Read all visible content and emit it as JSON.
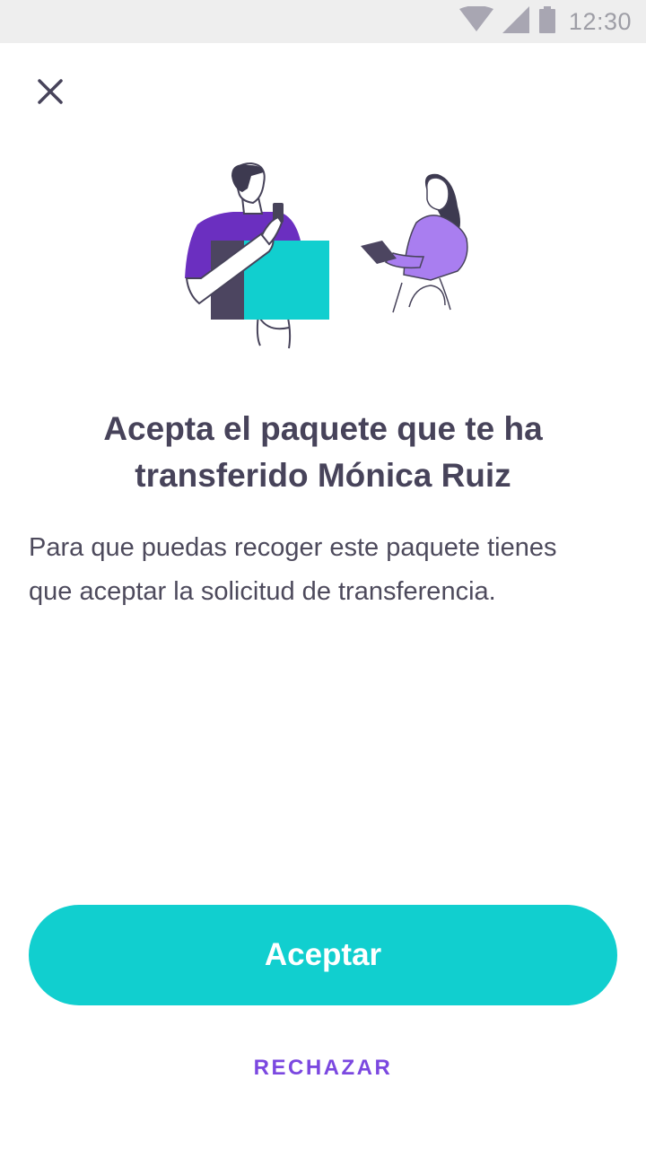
{
  "status_bar": {
    "time": "12:30",
    "icons": [
      "wifi-icon",
      "signal-icon",
      "battery-icon"
    ]
  },
  "header": {
    "close_icon": "close-icon"
  },
  "illustration": {
    "name": "package-transfer-illustration"
  },
  "content": {
    "title": "Acepta el paquete que te ha transferido Mónica Ruiz",
    "body": "Para que puedas recoger este paquete tienes que aceptar la solicitud de transferencia."
  },
  "actions": {
    "accept_label": "Aceptar",
    "reject_label": "RECHAZAR"
  },
  "colors": {
    "accent_teal": "#11cfcf",
    "accent_purple": "#7b48e0",
    "text_dark": "#47435a"
  }
}
